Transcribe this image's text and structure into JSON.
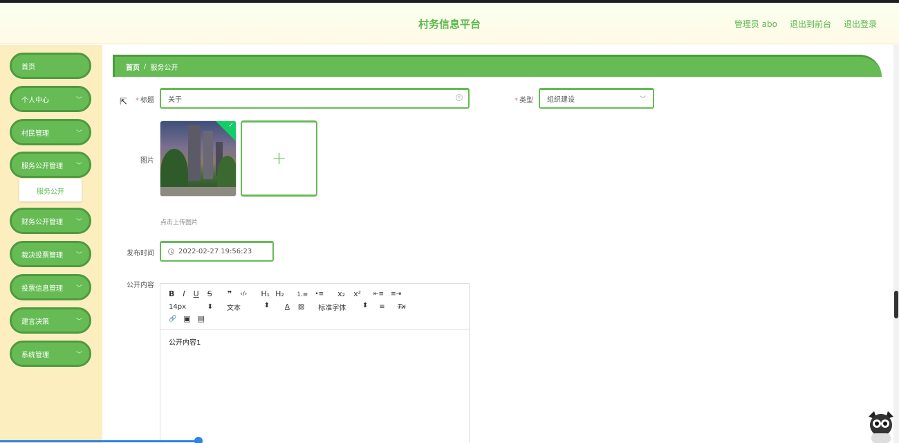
{
  "header": {
    "title": "村务信息平台",
    "admin_label": "管理员 abo",
    "front_link": "退出到前台",
    "logout_link": "退出登录"
  },
  "sidebar": {
    "items": [
      {
        "label": "首页",
        "has_chevron": false
      },
      {
        "label": "个人中心",
        "has_chevron": true
      },
      {
        "label": "村民管理",
        "has_chevron": true
      },
      {
        "label": "服务公开管理",
        "has_chevron": true
      },
      {
        "label": "财务公开管理",
        "has_chevron": true
      },
      {
        "label": "裁决投票管理",
        "has_chevron": true
      },
      {
        "label": "投票信息管理",
        "has_chevron": true
      },
      {
        "label": "建言决策",
        "has_chevron": true
      },
      {
        "label": "系统管理",
        "has_chevron": true
      }
    ],
    "submenu_active": "服务公开"
  },
  "breadcrumb": {
    "home": "首页",
    "separator": "/",
    "current": "服务公开"
  },
  "form": {
    "required_mark": "*",
    "title_label": "标题",
    "title_value": "关于",
    "type_label": "类型",
    "type_value": "组织建设",
    "image_label": "图片",
    "upload_tip": "点击上传图片",
    "publish_time_label": "发布时间",
    "publish_time_value": "2022-02-27 19:56:23",
    "content_label": "公开内容",
    "content_value": "公开内容1"
  },
  "editor_toolbar": {
    "bold": "B",
    "italic": "I",
    "underline": "U",
    "strike": "S",
    "quote": "❞",
    "code": "‹/›",
    "h1": "H₁",
    "h2": "H₂",
    "ordered_list": "⒈≡",
    "bullet_list": "•≡",
    "subscript": "x₂",
    "superscript": "x²",
    "outdent": "⇤≡",
    "indent": "≡⇥",
    "font_size": "14px",
    "text_type": "文本",
    "font_family": "标准字体",
    "select_arrow": "⬍",
    "font_color": "A",
    "bg_color": "▨",
    "align": "≡",
    "clear_format": "Tx",
    "link": "🔗",
    "image": "▣",
    "video": "▤"
  },
  "colors": {
    "primary_green": "#66bb55",
    "dark_green": "#4e9a40",
    "sidebar_bg": "#fdeec0"
  }
}
